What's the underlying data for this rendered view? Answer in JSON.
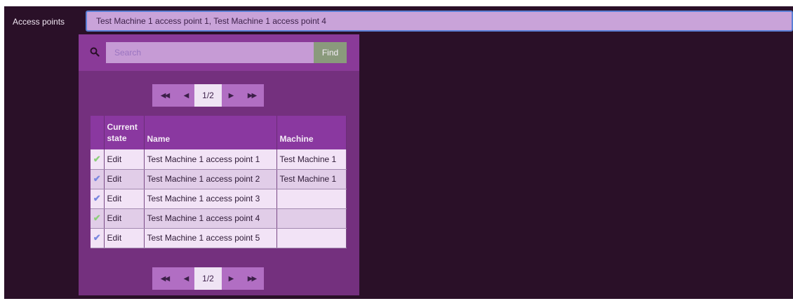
{
  "field": {
    "label": "Access points",
    "value": "Test Machine 1 access point 1, Test Machine 1 access point 4"
  },
  "search": {
    "placeholder": "Search",
    "find_label": "Find",
    "icon": "search-icon"
  },
  "pager_top": {
    "first": "◀◀",
    "prev": "◀",
    "current": "1/2",
    "next": "▶",
    "last": "▶▶"
  },
  "pager_bottom": {
    "first": "◀◀",
    "prev": "◀",
    "current": "1/2",
    "next": "▶",
    "last": "▶▶"
  },
  "table": {
    "headers": {
      "state_line1": "Current",
      "state_line2": "state",
      "name": "Name",
      "machine": "Machine"
    },
    "rows": [
      {
        "check": "✔",
        "check_color": "green",
        "state": "Edit",
        "name": "Test Machine 1 access point 1",
        "machine": "Test Machine 1"
      },
      {
        "check": "✔",
        "check_color": "blue",
        "state": "Edit",
        "name": "Test Machine 1 access point 2",
        "machine": "Test Machine 1"
      },
      {
        "check": "✔",
        "check_color": "blue",
        "state": "Edit",
        "name": "Test Machine 1 access point 3",
        "machine": ""
      },
      {
        "check": "✔",
        "check_color": "green",
        "state": "Edit",
        "name": "Test Machine 1 access point 4",
        "machine": ""
      },
      {
        "check": "✔",
        "check_color": "blue",
        "state": "Edit",
        "name": "Test Machine 1 access point 5",
        "machine": ""
      }
    ]
  },
  "colors": {
    "background": "#2a1028",
    "dropdown": "#74307e",
    "header": "#8a38a0",
    "select": "#c9a3d9",
    "check_green": "#8ccf7a",
    "check_blue": "#7a88df"
  }
}
